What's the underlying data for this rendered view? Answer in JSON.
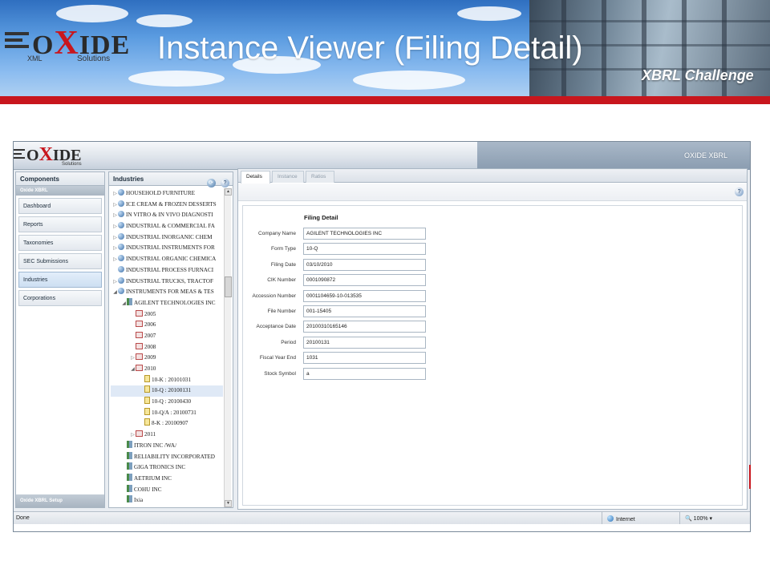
{
  "slide": {
    "title": "Instance Viewer (Filing Detail)",
    "subtitle": "XBRL Challenge",
    "logo": {
      "word_left": "O",
      "word_x": "X",
      "word_right": "IDE",
      "sub_left": "XML",
      "sub_right": "Solutions"
    }
  },
  "app": {
    "logo": {
      "word_left": "O",
      "word_x": "X",
      "word_right": "IDE",
      "sub": "Solutions"
    },
    "brand": "OXIDE XBRL"
  },
  "components": {
    "header": "Components",
    "group": "Oxide XBRL",
    "items": [
      "Dashboard",
      "Reports",
      "Taxonomies",
      "SEC Submissions",
      "Industries",
      "Corporations"
    ],
    "active": "Industries",
    "footer": "Oxide XBRL Setup"
  },
  "industries": {
    "header": "Industries",
    "tree": [
      {
        "label": "HOUSEHOLD FURNITURE",
        "icon": "globe-icon",
        "expander": "▷",
        "indent": 0
      },
      {
        "label": "ICE CREAM & FROZEN DESSERTS",
        "icon": "globe-icon",
        "expander": "▷",
        "indent": 0
      },
      {
        "label": "IN VITRO & IN VIVO DIAGNOSTI",
        "icon": "globe-icon",
        "expander": "▷",
        "indent": 0
      },
      {
        "label": "INDUSTRIAL & COMMERCIAL FA",
        "icon": "globe-icon",
        "expander": "▷",
        "indent": 0
      },
      {
        "label": "INDUSTRIAL INORGANIC CHEM",
        "icon": "globe-icon",
        "expander": "▷",
        "indent": 0
      },
      {
        "label": "INDUSTRIAL INSTRUMENTS FOR",
        "icon": "globe-icon",
        "expander": "▷",
        "indent": 0
      },
      {
        "label": "INDUSTRIAL ORGANIC CHEMICA",
        "icon": "globe-icon",
        "expander": "▷",
        "indent": 0
      },
      {
        "label": "INDUSTRIAL PROCESS FURNACI",
        "icon": "globe-icon",
        "expander": "",
        "indent": 0
      },
      {
        "label": "INDUSTRIAL TRUCKS, TRACTOF",
        "icon": "globe-icon",
        "expander": "▷",
        "indent": 0
      },
      {
        "label": "INSTRUMENTS FOR MEAS & TES",
        "icon": "globe-icon",
        "expander": "◢",
        "indent": 0
      },
      {
        "label": "AGILENT TECHNOLOGIES INC",
        "icon": "building-icon",
        "expander": "◢",
        "indent": 1
      },
      {
        "label": "2005",
        "icon": "year-icon",
        "expander": "",
        "indent": 2
      },
      {
        "label": "2006",
        "icon": "year-icon",
        "expander": "",
        "indent": 2
      },
      {
        "label": "2007",
        "icon": "year-icon",
        "expander": "",
        "indent": 2
      },
      {
        "label": "2008",
        "icon": "year-icon",
        "expander": "",
        "indent": 2
      },
      {
        "label": "2009",
        "icon": "year-icon",
        "expander": "▷",
        "indent": 2
      },
      {
        "label": "2010",
        "icon": "year-icon",
        "expander": "◢",
        "indent": 2
      },
      {
        "label": "10-K : 20101031",
        "icon": "document-icon",
        "expander": "",
        "indent": 3
      },
      {
        "label": "10-Q : 20100131",
        "icon": "document-icon",
        "expander": "",
        "indent": 3,
        "selected": true
      },
      {
        "label": "10-Q : 20100430",
        "icon": "document-icon",
        "expander": "",
        "indent": 3
      },
      {
        "label": "10-Q/A : 20100731",
        "icon": "document-icon",
        "expander": "",
        "indent": 3
      },
      {
        "label": "8-K : 20100907",
        "icon": "document-icon",
        "expander": "",
        "indent": 3
      },
      {
        "label": "2011",
        "icon": "year-icon",
        "expander": "▷",
        "indent": 2
      },
      {
        "label": "ITRON INC /WA/",
        "icon": "building-icon",
        "expander": "",
        "indent": 1
      },
      {
        "label": "RELIABILITY INCORPORATED",
        "icon": "building-icon",
        "expander": "",
        "indent": 1
      },
      {
        "label": "GIGA TRONICS INC",
        "icon": "building-icon",
        "expander": "",
        "indent": 1
      },
      {
        "label": "AETRIUM INC",
        "icon": "building-icon",
        "expander": "",
        "indent": 1
      },
      {
        "label": "COHU INC",
        "icon": "building-icon",
        "expander": "",
        "indent": 1
      },
      {
        "label": "Ixia",
        "icon": "building-icon",
        "expander": "",
        "indent": 1
      }
    ]
  },
  "detail": {
    "tabs": [
      "Details",
      "Instance",
      "Ratios"
    ],
    "active_tab": "Details",
    "form_title": "Filing Detail",
    "fields": [
      {
        "label": "Company Name",
        "value": "AGILENT TECHNOLOGIES INC"
      },
      {
        "label": "Form Type",
        "value": "10-Q"
      },
      {
        "label": "Filing Date",
        "value": "03/10/2010"
      },
      {
        "label": "CIK Number",
        "value": "0001090872"
      },
      {
        "label": "Accession Number",
        "value": "0001104659-10-013535"
      },
      {
        "label": "File Number",
        "value": "001-15405"
      },
      {
        "label": "Acceptance Date",
        "value": "20100310165146"
      },
      {
        "label": "Period",
        "value": "20100131"
      },
      {
        "label": "Fiscal Year End",
        "value": "1031"
      },
      {
        "label": "Stock Symbol",
        "value": "a"
      }
    ]
  },
  "statusbar": {
    "left": "Done",
    "zone": "Internet",
    "zoom": "100%"
  },
  "colors": {
    "brand_red": "#c8161d",
    "selection": "#dfe9f6"
  }
}
